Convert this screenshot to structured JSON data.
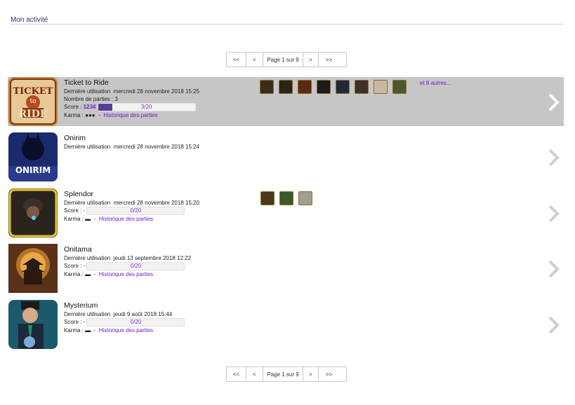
{
  "header": {
    "title": "Mon activité"
  },
  "pagination": {
    "first": "<<",
    "prev": "<",
    "info": "Page 1 sur 9",
    "next": ">",
    "last": ">>"
  },
  "labels": {
    "last_used": "Dernière utilisation",
    "nb_parties": "Nombre de parties : 3",
    "score_prefix": "Score : ",
    "score_dash": "Score : -",
    "karma_prefix": "Karma : ",
    "history_link": "Historique des parties",
    "dash": "-"
  },
  "games": [
    {
      "name": "Ticket to Ride",
      "last_used": "mercredi 28 novembre 2018 15:25",
      "score": "1234",
      "progress": "3/20",
      "progress_fraction": 0.15,
      "karma": "●●●",
      "more_trophies": "et 8 autres...",
      "thumb_text_1": "TICKET",
      "thumb_text_2": "to",
      "thumb_text_3": "RIDE",
      "trophy_icons": [
        "trophy-icon-1",
        "trophy-icon-2",
        "trophy-icon-3",
        "trophy-icon-4",
        "trophy-icon-5",
        "trophy-icon-6",
        "trophy-icon-7",
        "trophy-icon-8"
      ],
      "trophy_colors": [
        "#3a2d1c",
        "#2c2418",
        "#5a2a14",
        "#1c1c1c",
        "#1e2a3c",
        "#3c3028",
        "#c8b8a0",
        "#4a5a2a"
      ]
    },
    {
      "name": "Onirim",
      "last_used": "mercredi 28 novembre 2018 15:24",
      "thumb_text_1": "ONIRIM"
    },
    {
      "name": "Splendor",
      "last_used": "mercredi 28 novembre 2018 15:20",
      "progress": "0/20",
      "progress_fraction": 0,
      "karma": "▬",
      "trophy_icons": [
        "trophy-icon-1",
        "trophy-icon-2",
        "trophy-icon-3"
      ],
      "trophy_colors": [
        "#4a3a1a",
        "#3a5a2a",
        "#a0a090"
      ]
    },
    {
      "name": "Onitama",
      "last_used": "jeudi 13 septembre 2018 12:22",
      "progress": "0/20",
      "progress_fraction": 0,
      "karma": "▬"
    },
    {
      "name": "Mysterium",
      "last_used": "jeudi 9 août 2018 15:44",
      "progress": "0/20",
      "progress_fraction": 0,
      "karma": "▬"
    }
  ],
  "colors": {
    "accent": "#6a1fc8",
    "active_row": "#c6c6c6",
    "bar_fill": "#5b3a98"
  }
}
